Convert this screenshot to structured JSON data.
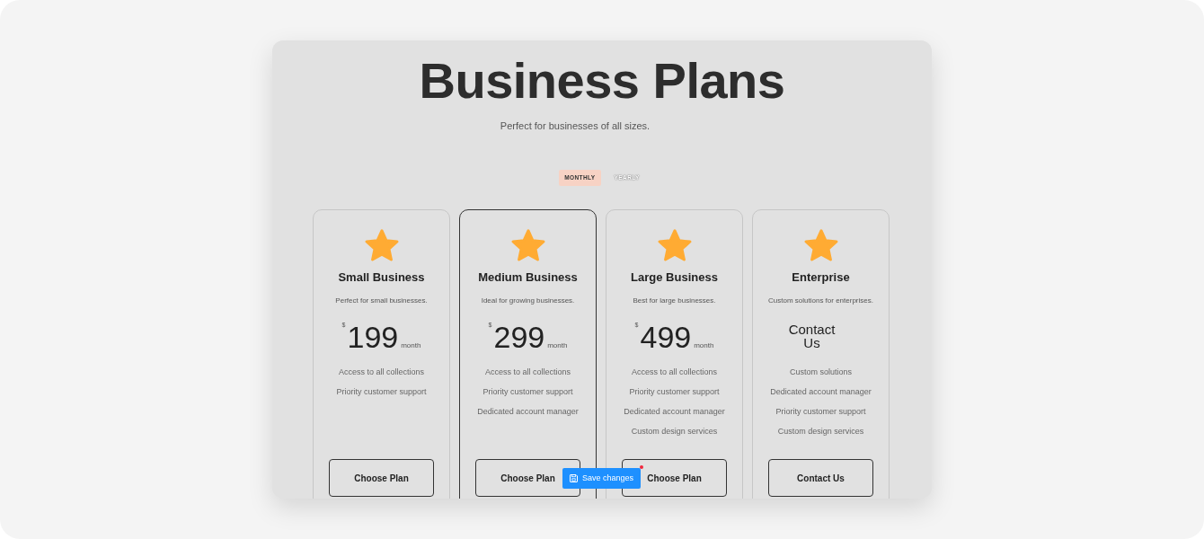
{
  "title": "Business Plans",
  "subtitle": "Perfect for businesses of all sizes.",
  "billing_toggle": [
    {
      "label": "MONTHLY",
      "selected": true
    },
    {
      "label": "YEARLY",
      "selected": false
    }
  ],
  "plans": [
    {
      "kind": "price",
      "name": "Small Business",
      "description": "Perfect for small businesses.",
      "currency": "$",
      "price": "199",
      "period": "month",
      "features": [
        "Access to all collections",
        "Priority customer support"
      ],
      "button": "Choose Plan",
      "selected": false
    },
    {
      "kind": "price",
      "name": "Medium Business",
      "description": "Ideal for growing businesses.",
      "currency": "$",
      "price": "299",
      "period": "month",
      "features": [
        "Access to all collections",
        "Priority customer support",
        "Dedicated account manager"
      ],
      "button": "Choose Plan",
      "selected": true
    },
    {
      "kind": "price",
      "name": "Large Business",
      "description": "Best for large businesses.",
      "currency": "$",
      "price": "499",
      "period": "month",
      "features": [
        "Access to all collections",
        "Priority customer support",
        "Dedicated account manager",
        "Custom design services"
      ],
      "button": "Choose Plan",
      "selected": false
    },
    {
      "kind": "contact",
      "name": "Enterprise",
      "description": "Custom solutions for enterprises.",
      "price": "Contact Us",
      "features": [
        "Custom solutions",
        "Dedicated account manager",
        "Priority customer support",
        "Custom design services"
      ],
      "button": "Contact Us",
      "selected": false
    }
  ],
  "save_button": {
    "label": "Save changes",
    "unsaved": true
  }
}
